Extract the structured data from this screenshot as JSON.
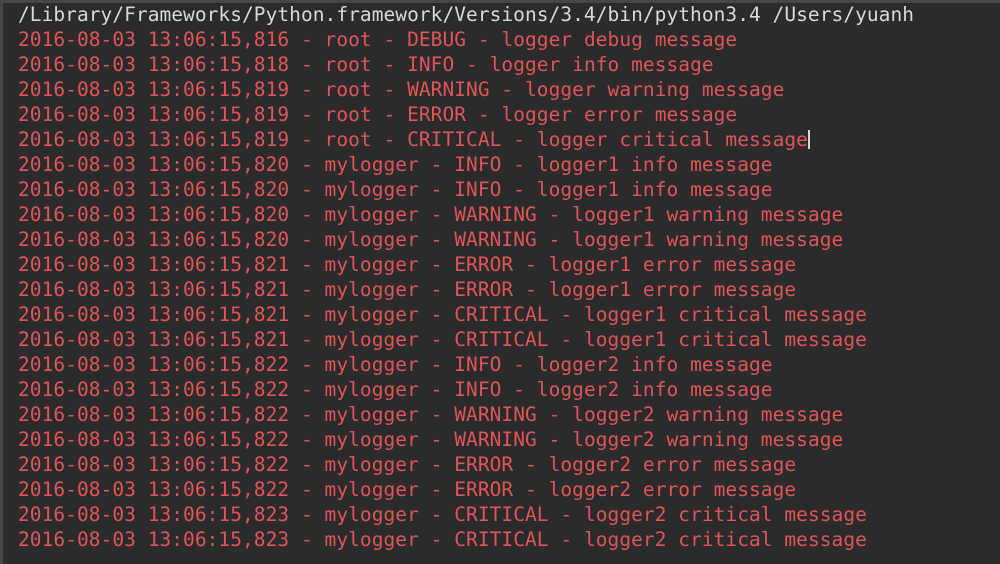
{
  "window": {
    "type": "terminal",
    "background_color": "#2b2b2b",
    "edge_color": "#464646",
    "command_text_color": "#d8d8d8",
    "log_text_color": "#e05555"
  },
  "command_line": {
    "text": "/Library/Frameworks/Python.framework/Versions/3.4/bin/python3.4 /Users/yuanh",
    "truncated_at_right_edge": true
  },
  "log_lines": [
    {
      "timestamp": "2016-08-03 13:06:15,816",
      "logger": "root",
      "level": "DEBUG",
      "message": "logger debug message"
    },
    {
      "timestamp": "2016-08-03 13:06:15,818",
      "logger": "root",
      "level": "INFO",
      "message": "logger info message"
    },
    {
      "timestamp": "2016-08-03 13:06:15,819",
      "logger": "root",
      "level": "WARNING",
      "message": "logger warning message"
    },
    {
      "timestamp": "2016-08-03 13:06:15,819",
      "logger": "root",
      "level": "ERROR",
      "message": "logger error message"
    },
    {
      "timestamp": "2016-08-03 13:06:15,819",
      "logger": "root",
      "level": "CRITICAL",
      "message": "logger critical message",
      "cursor_after": true
    },
    {
      "timestamp": "2016-08-03 13:06:15,820",
      "logger": "mylogger",
      "level": "INFO",
      "message": "logger1 info message"
    },
    {
      "timestamp": "2016-08-03 13:06:15,820",
      "logger": "mylogger",
      "level": "INFO",
      "message": "logger1 info message"
    },
    {
      "timestamp": "2016-08-03 13:06:15,820",
      "logger": "mylogger",
      "level": "WARNING",
      "message": "logger1 warning message"
    },
    {
      "timestamp": "2016-08-03 13:06:15,820",
      "logger": "mylogger",
      "level": "WARNING",
      "message": "logger1 warning message"
    },
    {
      "timestamp": "2016-08-03 13:06:15,821",
      "logger": "mylogger",
      "level": "ERROR",
      "message": "logger1 error message"
    },
    {
      "timestamp": "2016-08-03 13:06:15,821",
      "logger": "mylogger",
      "level": "ERROR",
      "message": "logger1 error message"
    },
    {
      "timestamp": "2016-08-03 13:06:15,821",
      "logger": "mylogger",
      "level": "CRITICAL",
      "message": "logger1 critical message"
    },
    {
      "timestamp": "2016-08-03 13:06:15,821",
      "logger": "mylogger",
      "level": "CRITICAL",
      "message": "logger1 critical message"
    },
    {
      "timestamp": "2016-08-03 13:06:15,822",
      "logger": "mylogger",
      "level": "INFO",
      "message": "logger2 info message"
    },
    {
      "timestamp": "2016-08-03 13:06:15,822",
      "logger": "mylogger",
      "level": "INFO",
      "message": "logger2 info message"
    },
    {
      "timestamp": "2016-08-03 13:06:15,822",
      "logger": "mylogger",
      "level": "WARNING",
      "message": "logger2 warning message"
    },
    {
      "timestamp": "2016-08-03 13:06:15,822",
      "logger": "mylogger",
      "level": "WARNING",
      "message": "logger2 warning message"
    },
    {
      "timestamp": "2016-08-03 13:06:15,822",
      "logger": "mylogger",
      "level": "ERROR",
      "message": "logger2 error message"
    },
    {
      "timestamp": "2016-08-03 13:06:15,822",
      "logger": "mylogger",
      "level": "ERROR",
      "message": "logger2 error message"
    },
    {
      "timestamp": "2016-08-03 13:06:15,823",
      "logger": "mylogger",
      "level": "CRITICAL",
      "message": "logger2 critical message"
    },
    {
      "timestamp": "2016-08-03 13:06:15,823",
      "logger": "mylogger",
      "level": "CRITICAL",
      "message": "logger2 critical message"
    }
  ],
  "separator": " - "
}
